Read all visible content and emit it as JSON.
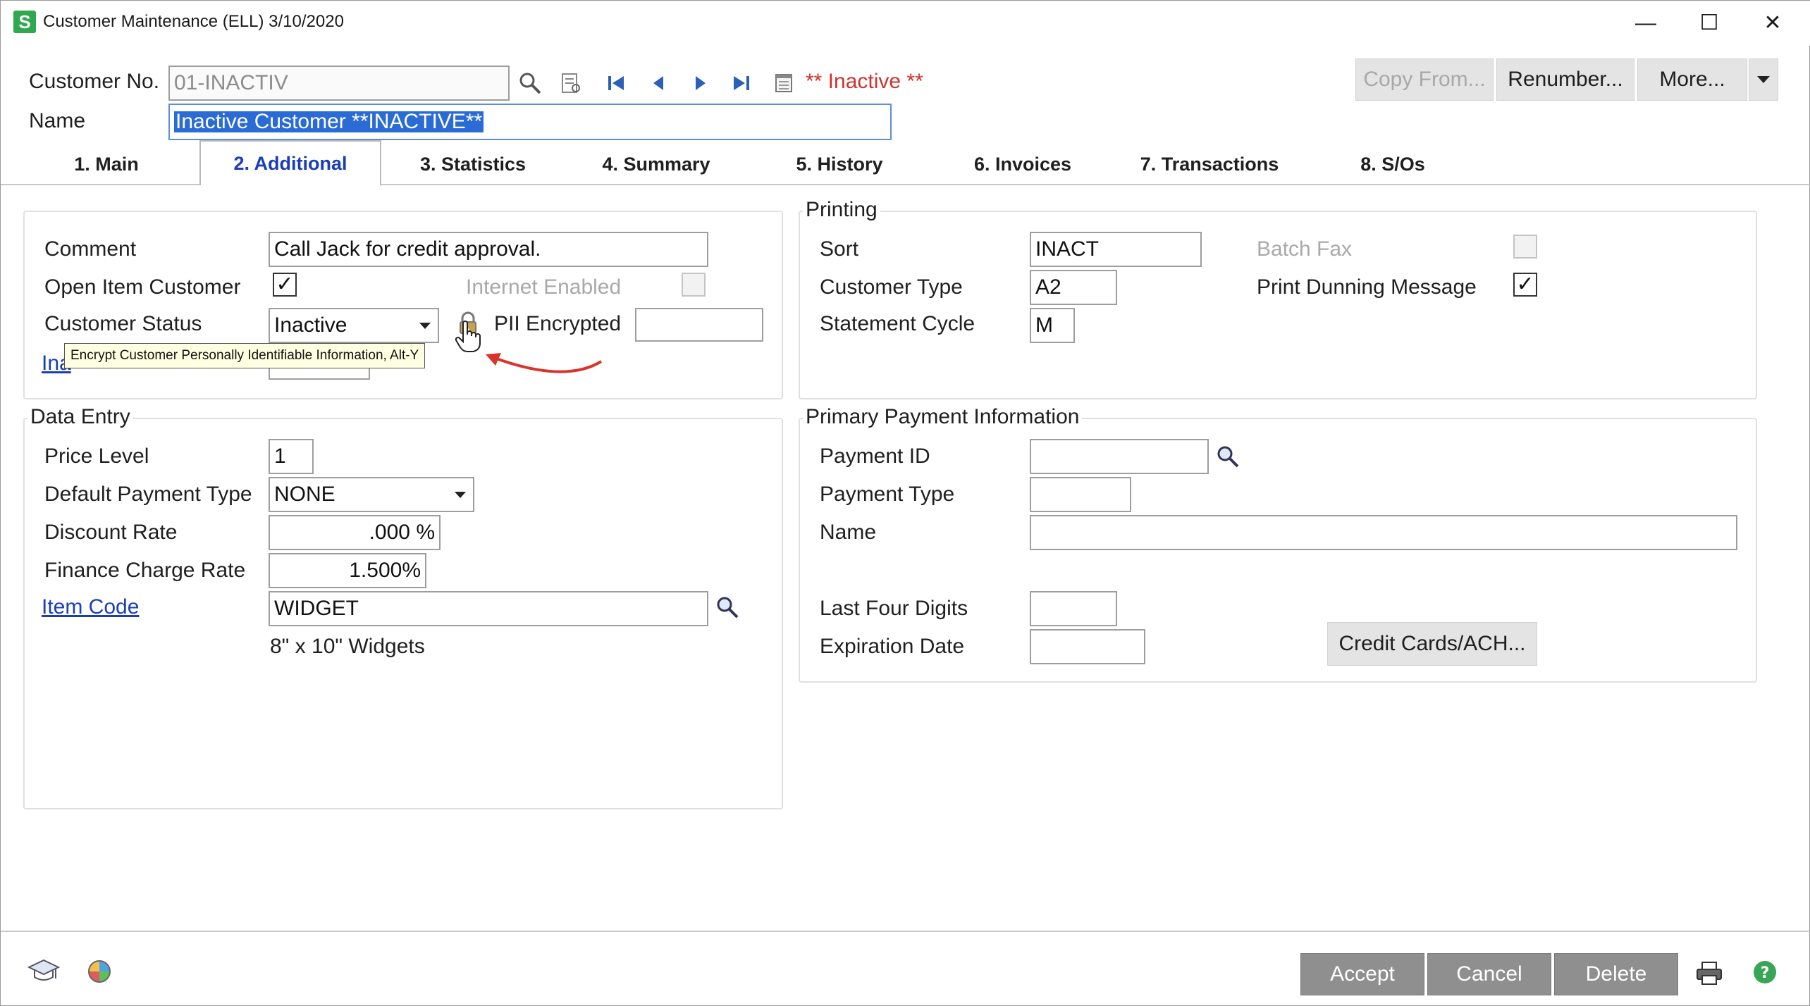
{
  "window": {
    "title": "Customer Maintenance (ELL) 3/10/2020",
    "app_icon_letter": "S",
    "minimize": "—",
    "maximize": "☐",
    "close": "✕"
  },
  "header": {
    "customer_no_label": "Customer No.",
    "customer_no_value": "01-INACTIV",
    "status_text": "** Inactive **",
    "status_color": "#d0312d",
    "name_label": "Name",
    "name_value": "Inactive Customer **INACTIVE**",
    "copy_from_label": "Copy From...",
    "renumber_label": "Renumber...",
    "more_label": "More..."
  },
  "tabs": [
    {
      "label": "1. Main"
    },
    {
      "label": "2. Additional"
    },
    {
      "label": "3. Statistics"
    },
    {
      "label": "4. Summary"
    },
    {
      "label": "5. History"
    },
    {
      "label": "6. Invoices"
    },
    {
      "label": "7. Transactions"
    },
    {
      "label": "8. S/Os"
    }
  ],
  "general": {
    "comment_label": "Comment",
    "comment_value": "Call Jack for credit approval.",
    "open_item_label": "Open Item Customer",
    "open_item_checked": "✓",
    "internet_enabled_label": "Internet Enabled",
    "status_label": "Customer Status",
    "status_value": "Inactive",
    "pii_label": "PII Encrypted",
    "inactive_link_partial": "Ina",
    "tooltip": "Encrypt Customer Personally Identifiable Information, Alt-Y"
  },
  "data_entry": {
    "title": "Data Entry",
    "price_level_label": "Price Level",
    "price_level_value": "1",
    "payment_type_label": "Default Payment Type",
    "payment_type_value": "NONE",
    "discount_label": "Discount Rate",
    "discount_value": ".000 %",
    "finance_label": "Finance Charge Rate",
    "finance_value": "1.500%",
    "item_code_label": "Item Code",
    "item_code_value": "WIDGET",
    "item_desc": "8\" x 10\" Widgets"
  },
  "printing": {
    "title": "Printing",
    "sort_label": "Sort",
    "sort_value": "INACT",
    "customer_type_label": "Customer Type",
    "customer_type_value": "A2",
    "statement_cycle_label": "Statement Cycle",
    "statement_cycle_value": "M",
    "batch_fax_label": "Batch Fax",
    "dunning_label": "Print Dunning Message",
    "dunning_checked": "✓"
  },
  "payment": {
    "title": "Primary Payment Information",
    "payment_id_label": "Payment ID",
    "payment_type_label": "Payment Type",
    "name_label": "Name",
    "last_four_label": "Last Four Digits",
    "expiration_label": "Expiration Date",
    "credit_cards_label": "Credit Cards/ACH..."
  },
  "footer": {
    "accept_label": "Accept",
    "cancel_label": "Cancel",
    "delete_label": "Delete"
  },
  "colors": {
    "link": "#1a3db8",
    "annotation_arrow": "#d9342b",
    "selection": "#2a6bd6"
  }
}
